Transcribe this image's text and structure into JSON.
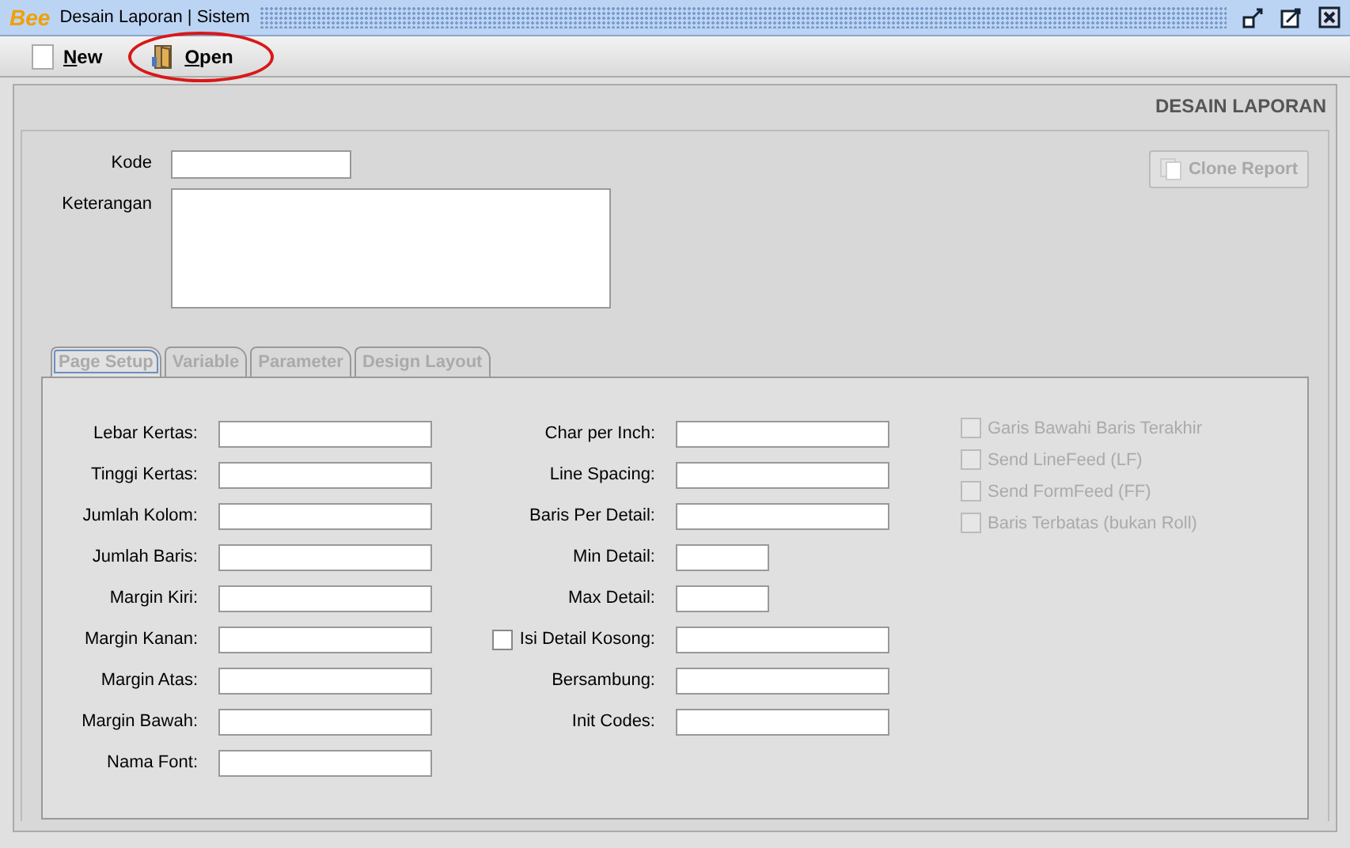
{
  "window": {
    "logo": "Bee",
    "title": "Desain Laporan | Sistem"
  },
  "toolbar": [
    {
      "label": "New",
      "kind": "new"
    },
    {
      "label": "Open",
      "kind": "open",
      "highlighted": true
    }
  ],
  "header": "DESAIN LAPORAN",
  "form": {
    "kode_label": "Kode",
    "keterangan_label": "Keterangan",
    "clone_button": {
      "label": "Clone Report",
      "disabled": true
    }
  },
  "tabs": [
    {
      "label": "Page Setup",
      "selected": true
    },
    {
      "label": "Variable",
      "selected": false
    },
    {
      "label": "Parameter",
      "selected": false
    },
    {
      "label": "Design Layout",
      "selected": false
    }
  ],
  "left_fields": [
    {
      "label": "Lebar Kertas:"
    },
    {
      "label": "Tinggi Kertas:"
    },
    {
      "label": "Jumlah Kolom:"
    },
    {
      "label": "Jumlah Baris:"
    },
    {
      "label": "Margin Kiri:"
    },
    {
      "label": "Margin Kanan:"
    },
    {
      "label": "Margin Atas:"
    },
    {
      "label": "Margin Bawah:"
    },
    {
      "label": "Nama Font:"
    }
  ],
  "middle_fields": [
    {
      "label": "Char per Inch:",
      "kind": "long"
    },
    {
      "label": "Line Spacing:",
      "kind": "long"
    },
    {
      "label": "Baris Per Detail:",
      "kind": "long"
    },
    {
      "label": "Min Detail:",
      "kind": "short"
    },
    {
      "label": "Max Detail:",
      "kind": "short"
    },
    {
      "label": "Isi Detail Kosong:",
      "kind": "checkbox",
      "checked": false
    },
    {
      "label": "Bersambung:",
      "kind": "long"
    },
    {
      "label": "Init Codes:",
      "kind": "long"
    }
  ],
  "options": [
    {
      "label": "Garis Bawahi Baris Terakhir",
      "checked": false,
      "disabled": true
    },
    {
      "label": "Send LineFeed (LF)",
      "checked": false,
      "disabled": true
    },
    {
      "label": "Send FormFeed (FF)",
      "checked": false,
      "disabled": true
    },
    {
      "label": "Baris Terbatas (bukan Roll)",
      "checked": false,
      "disabled": true
    }
  ]
}
